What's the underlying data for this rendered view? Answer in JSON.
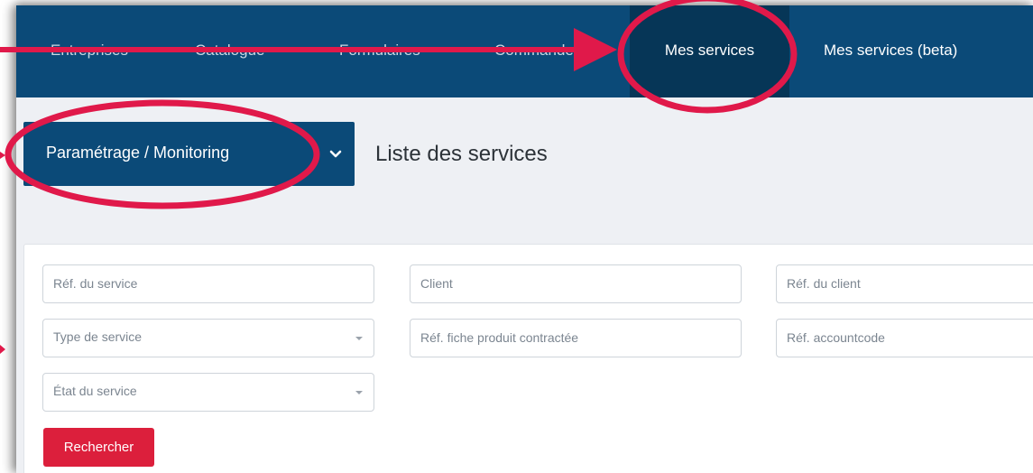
{
  "nav": {
    "items": [
      {
        "label": "Entreprises"
      },
      {
        "label": "Catalogue"
      },
      {
        "label": "Formulaires"
      },
      {
        "label": "Commandes"
      },
      {
        "label": "Mes services"
      },
      {
        "label": "Mes services (beta)"
      }
    ],
    "active_index": 4
  },
  "menu": {
    "label": "Paramétrage / Monitoring",
    "icon": "chevron-down-icon"
  },
  "page": {
    "title": "Liste des services"
  },
  "filters": {
    "service_ref": "Réf. du service",
    "client": "Client",
    "client_ref": "Réf. du client",
    "service_type": "Type de service",
    "product_ref": "Réf. fiche produit contractée",
    "accountcode_ref": "Réf. accountcode",
    "service_state": "État du service"
  },
  "actions": {
    "search_label": "Rechercher"
  },
  "colors": {
    "nav_bg": "#0b4a78",
    "nav_active": "#063657",
    "annotation": "#e0194a",
    "search_button": "#dc1f3c"
  }
}
